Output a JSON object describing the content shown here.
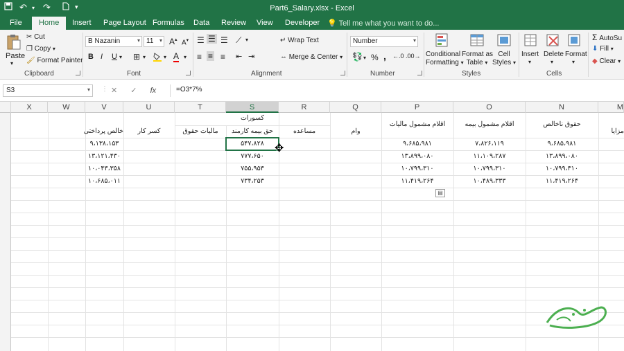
{
  "window": {
    "title": "Part6_Salary.xlsx - Excel",
    "titlebar_color": "#217346"
  },
  "quick_access": {
    "save_icon": "save-icon",
    "undo_icon": "undo-icon",
    "redo_icon": "redo-icon",
    "new_icon": "new-file-icon",
    "customize_icon": "chevron-down-icon"
  },
  "tabs": [
    {
      "label": "File"
    },
    {
      "label": "Home",
      "active": true
    },
    {
      "label": "Insert"
    },
    {
      "label": "Page Layout"
    },
    {
      "label": "Formulas"
    },
    {
      "label": "Data"
    },
    {
      "label": "Review"
    },
    {
      "label": "View"
    },
    {
      "label": "Developer"
    }
  ],
  "tellme": "Tell me what you want to do...",
  "ribbon": {
    "clipboard": {
      "label": "Clipboard",
      "paste": "Paste",
      "cut": "Cut",
      "copy": "Copy",
      "format_painter": "Format Painter"
    },
    "font": {
      "label": "Font",
      "font_name": "B Nazanin",
      "font_size": "11",
      "bold": "B",
      "italic": "I",
      "underline": "U",
      "grow": "A",
      "shrink": "A"
    },
    "alignment": {
      "label": "Alignment",
      "wrap_text": "Wrap Text",
      "merge_center": "Merge & Center"
    },
    "number": {
      "label": "Number",
      "format": "Number",
      "percent": "%",
      "comma": ","
    },
    "styles": {
      "label": "Styles",
      "conditional_formatting": [
        "Conditional",
        "Formatting"
      ],
      "format_as_table": [
        "Format as",
        "Table"
      ],
      "cell_styles": [
        "Cell",
        "Styles"
      ]
    },
    "cells": {
      "label": "Cells",
      "insert": "Insert",
      "delete": "Delete",
      "format": "Format"
    },
    "editing": {
      "autosum": "AutoSu",
      "fill": "Fill",
      "clear": "Clear"
    }
  },
  "formula_bar": {
    "name_box": "S3",
    "cancel": "✕",
    "enter": "✓",
    "fx": "fx",
    "formula": "=O3*7%"
  },
  "columns": [
    "X",
    "W",
    "V",
    "U",
    "T",
    "S",
    "R",
    "Q",
    "P",
    "O",
    "N",
    "M"
  ],
  "selected_column": "S",
  "sheet": {
    "merged_header": "کسورات",
    "headers": {
      "V": "خالص پرداختی",
      "U": "کسر کار",
      "T": "مالیات حقوق",
      "S": "حق بیمه کارمند",
      "R": "مساعده",
      "Q": "وام",
      "P": "اقلام مشمول مالیات",
      "O": "اقلام مشمول بیمه",
      "N": "حقوق ناخالص",
      "M": "مزایا"
    },
    "rows": [
      {
        "V": "۹،۱۳۸،۱۵۳",
        "S": "۵۴۷،۸۲۸",
        "P": "۹،۶۸۵،۹۸۱",
        "O": "۷،۸۲۶،۱۱۹",
        "N": "۹،۶۸۵،۹۸۱"
      },
      {
        "V": "۱۳،۱۲۱،۴۳۰",
        "S": "۷۷۷،۶۵۰",
        "P": "۱۳،۸۹۹،۰۸۰",
        "O": "۱۱،۱۰۹،۲۸۷",
        "N": "۱۳،۸۹۹،۰۸۰"
      },
      {
        "V": "۱۰،۰۴۳،۳۵۸",
        "S": "۷۵۵،۹۵۳",
        "P": "۱۰،۷۹۹،۳۱۰",
        "O": "۱۰،۷۹۹،۳۱۰",
        "N": "۱۰،۷۹۹،۳۱۰"
      },
      {
        "V": "۱۰،۶۸۵،۰۱۱",
        "S": "۷۳۴،۲۵۳",
        "P": "۱۱،۴۱۹،۲۶۴",
        "O": "۱۰،۴۸۹،۳۳۳",
        "N": "۱۱،۴۱۹،۲۶۴"
      }
    ]
  }
}
